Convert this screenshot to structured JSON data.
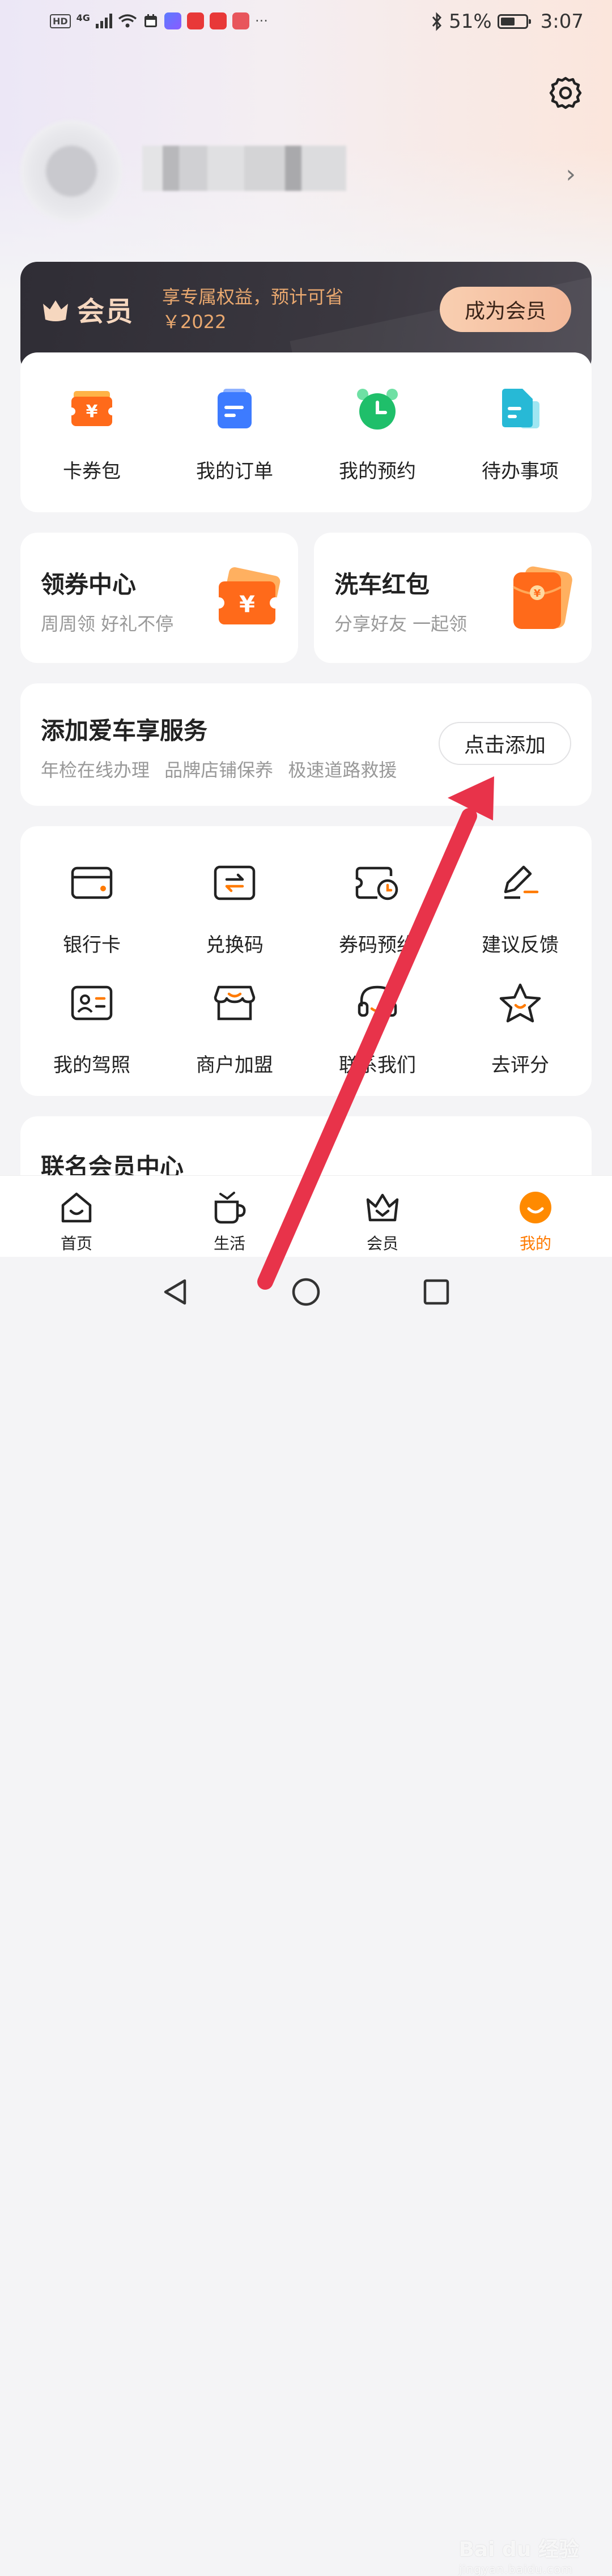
{
  "status_bar": {
    "battery": "51%",
    "time": "3:07",
    "network": "4G",
    "hd": "HD"
  },
  "profile": {
    "username": ""
  },
  "member": {
    "title": "会员",
    "desc": "享专属权益，预计可省￥2022",
    "button": "成为会员"
  },
  "quick_actions": [
    {
      "label": "卡券包",
      "icon": "coupon-wallet-icon"
    },
    {
      "label": "我的订单",
      "icon": "order-icon"
    },
    {
      "label": "我的预约",
      "icon": "alarm-clock-icon"
    },
    {
      "label": "待办事项",
      "icon": "todo-icon"
    }
  ],
  "promos": [
    {
      "title": "领券中心",
      "subtitle": "周周领 好礼不停",
      "icon": "ticket-icon"
    },
    {
      "title": "洗车红包",
      "subtitle": "分享好友 一起领",
      "icon": "red-envelope-icon"
    }
  ],
  "add_car": {
    "title": "添加爱车享服务",
    "subtitle": "年检在线办理 品牌店铺保养 极速道路救援",
    "button": "点击添加"
  },
  "services": [
    {
      "label": "银行卡",
      "icon": "bank-card-icon"
    },
    {
      "label": "兑换码",
      "icon": "exchange-code-icon"
    },
    {
      "label": "券码预约",
      "icon": "code-reservation-icon"
    },
    {
      "label": "建议反馈",
      "icon": "feedback-pen-icon"
    },
    {
      "label": "我的驾照",
      "icon": "driver-license-icon"
    },
    {
      "label": "商户加盟",
      "icon": "merchant-shop-icon"
    },
    {
      "label": "联系我们",
      "icon": "headset-icon"
    },
    {
      "label": "去评分",
      "icon": "star-icon"
    }
  ],
  "joint_member": {
    "title": "联名会员中心"
  },
  "tabs": [
    {
      "label": "首页",
      "icon": "home-icon"
    },
    {
      "label": "生活",
      "icon": "cup-icon"
    },
    {
      "label": "会员",
      "icon": "crown-icon"
    },
    {
      "label": "我的",
      "icon": "smile-icon",
      "active": true
    }
  ],
  "watermark": {
    "brand": "Bai du 经验",
    "url": "jingyan.baidu.com"
  },
  "colors": {
    "accent": "#ff7a00",
    "annotation_arrow": "#e8334a",
    "member_bg": "#2f2d35"
  }
}
